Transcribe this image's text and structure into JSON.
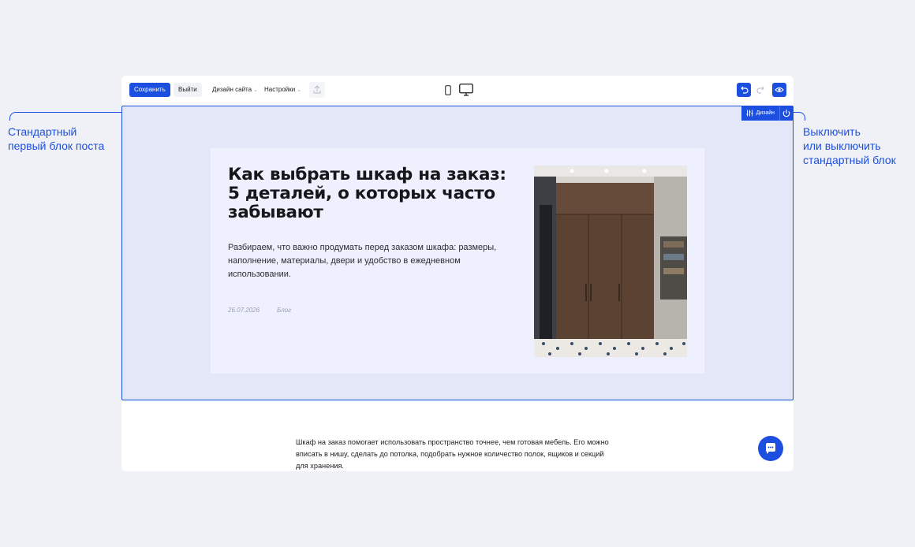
{
  "annotations": {
    "left": [
      "Стандартный",
      "первый блок поста"
    ],
    "right": [
      "Выключить",
      "или выключить",
      "стандартный блок"
    ]
  },
  "toolbar": {
    "save_label": "Сохранить",
    "exit_label": "Выйти",
    "site_design_label": "Дизайн сайта",
    "settings_label": "Настройки",
    "caret": "⌄",
    "accent": "#1c4fe0",
    "icons": [
      "export-icon",
      "mobile-icon",
      "desktop-icon",
      "undo-icon",
      "redo-icon",
      "eye-icon"
    ]
  },
  "block": {
    "design_label": "Дизайн",
    "icons": [
      "sliders-icon",
      "power-icon"
    ]
  },
  "post": {
    "title": "Как выбрать шкаф на заказ: 5 деталей, о которых часто забывают",
    "lead": "Разбираем, что важно продумать перед заказом шкафа: размеры, наполнение, материалы, двери и удобство в ежедневном использовании.",
    "date": "26.07.2026",
    "category": "Блог",
    "body": "Шкаф на заказ помогает использовать пространство точнее, чем готовая мебель. Его можно вписать в нишу, сделать до потолка, подобрать нужное количество полок, ящиков и секций для хранения."
  },
  "chat": {
    "icon": "chat-icon"
  }
}
